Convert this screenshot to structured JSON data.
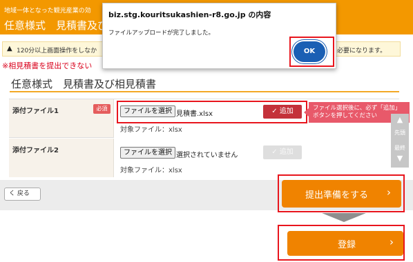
{
  "header": {
    "subtitle": "地域一体となった観光産業の効",
    "title": "任意様式　見積書及び"
  },
  "warning": {
    "icon": "warning-icon",
    "text_left": "120分以上画面操作をしなか",
    "text_right": "必要になります。"
  },
  "note": "※相見積書を提出できない",
  "section_title": "任意様式　見積書及び相見積書",
  "rows": [
    {
      "label": "添付ファイル1",
      "required": "必須",
      "file_button": "ファイルを選択",
      "file_name": "見積書.xlsx",
      "target": "対象ファイル：xlsx",
      "add_label": "✓ 追加"
    },
    {
      "label": "添付ファイル2",
      "file_button": "ファイルを選択",
      "file_name": "選択されていません",
      "target": "対象ファイル：xlsx",
      "add_label": "✓ 追加"
    }
  ],
  "tooltip": {
    "line1": "ファイル選択後に、必ず「追加」",
    "line2": "ボタンを押してください"
  },
  "side_nav": {
    "top": "先頭",
    "bottom": "最終"
  },
  "back_button": "く 戻る",
  "prepare_button": "提出準備をする",
  "register_button": "登録",
  "dialog": {
    "title": "biz.stg.kouritsukashien-r8.go.jp の内容",
    "message": "ファイルアップロードが完了しました。",
    "ok_label": "OK"
  },
  "colors": {
    "accent": "#f39800",
    "button_orange": "#f08300",
    "add_red": "#c4313a",
    "required_red": "#e55d5d",
    "tooltip": "#e8596a",
    "highlight_red": "#e8141c",
    "ok_blue": "#1a5fb4"
  }
}
